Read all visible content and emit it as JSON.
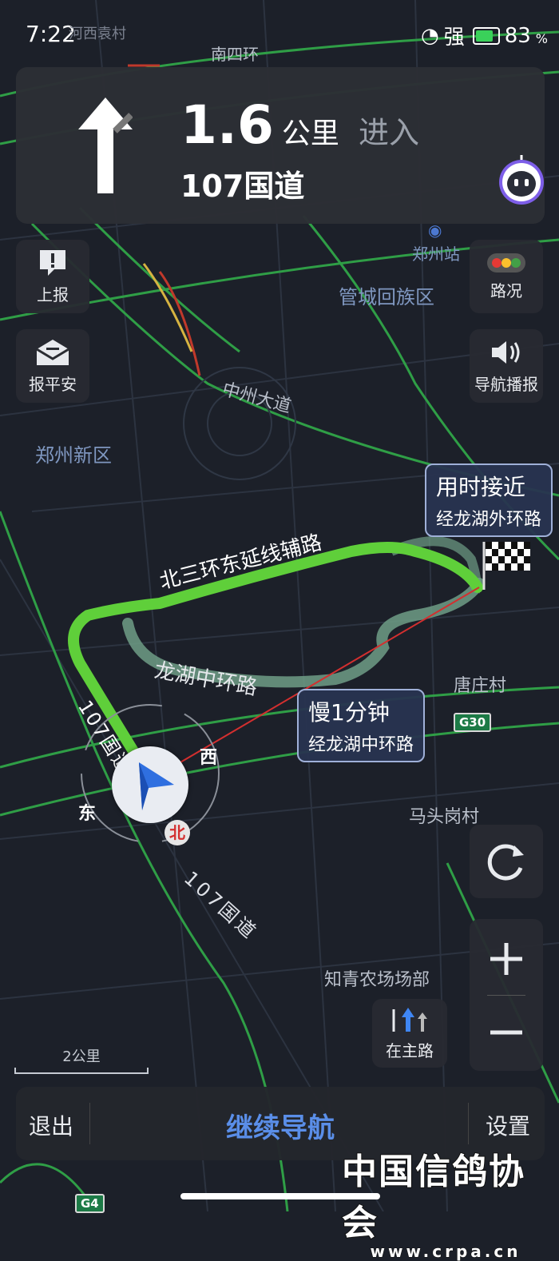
{
  "status": {
    "time": "7:22",
    "signal": "强",
    "battery": "83",
    "battery_unit": "%"
  },
  "guide": {
    "distance": "1.6",
    "unit": "公里",
    "action": "进入",
    "road": "107国道"
  },
  "left_buttons": [
    {
      "label": "上报",
      "icon": "report-icon"
    },
    {
      "label": "报平安",
      "icon": "safe-message-icon"
    }
  ],
  "right_buttons": [
    {
      "label": "路况",
      "icon": "traffic-lights-icon"
    },
    {
      "label": "导航播报",
      "icon": "speaker-icon"
    }
  ],
  "map_labels": {
    "top_village": "河西袁村",
    "south_ring4": "南四环",
    "zhengzhou_station": "郑州站",
    "guancheng": "管城回族区",
    "zhongzhou": "中州大道",
    "new_district": "郑州新区",
    "north_ring3": "北三环东延线辅路",
    "longhu_mid": "龙湖中环路",
    "tangzhuang": "唐庄村",
    "g30": "G30",
    "matougang": "马头岗村",
    "road107": "107国道",
    "road107_near": "107国道",
    "farm": "知青农场场部",
    "g4": "G4"
  },
  "compass": {
    "west": "西",
    "east": "东",
    "north": "北"
  },
  "callouts": {
    "fast": {
      "title": "用时接近",
      "sub": "经龙湖外环路"
    },
    "slow": {
      "title": "慢1分钟",
      "sub": "经龙湖中环路"
    }
  },
  "map_controls": {
    "main_road": "在主路"
  },
  "scale": "2公里",
  "bottom": {
    "exit": "退出",
    "continue": "继续导航",
    "settings": "设置"
  },
  "watermark": {
    "title": "中国信鸽协会",
    "url": "www.crpa.cn"
  },
  "colors": {
    "route_green": "#5fcf3a",
    "alt_route": "#6f9e86",
    "accent_blue": "#5a8ee8",
    "direct_line": "#d32f2f"
  }
}
